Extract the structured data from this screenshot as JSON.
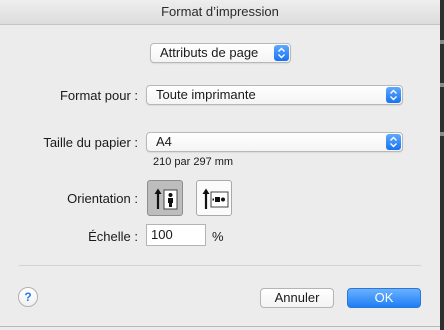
{
  "window": {
    "title": "Format d’impression"
  },
  "settings_menu": {
    "value": "Attributs de page"
  },
  "format_for": {
    "label": "Format pour :",
    "value": "Toute imprimante"
  },
  "paper_size": {
    "label": "Taille du papier :",
    "value": "A4",
    "dimensions": "210 par 297 mm"
  },
  "orientation": {
    "label": "Orientation :",
    "options": [
      {
        "name": "portrait",
        "selected": true
      },
      {
        "name": "landscape",
        "selected": false
      }
    ]
  },
  "scale": {
    "label": "Échelle :",
    "value": "100",
    "unit": "%"
  },
  "help": {
    "glyph": "?"
  },
  "buttons": {
    "cancel": "Annuler",
    "ok": "OK"
  },
  "colors": {
    "accent": "#1f7ef5",
    "background": "#ececec"
  }
}
